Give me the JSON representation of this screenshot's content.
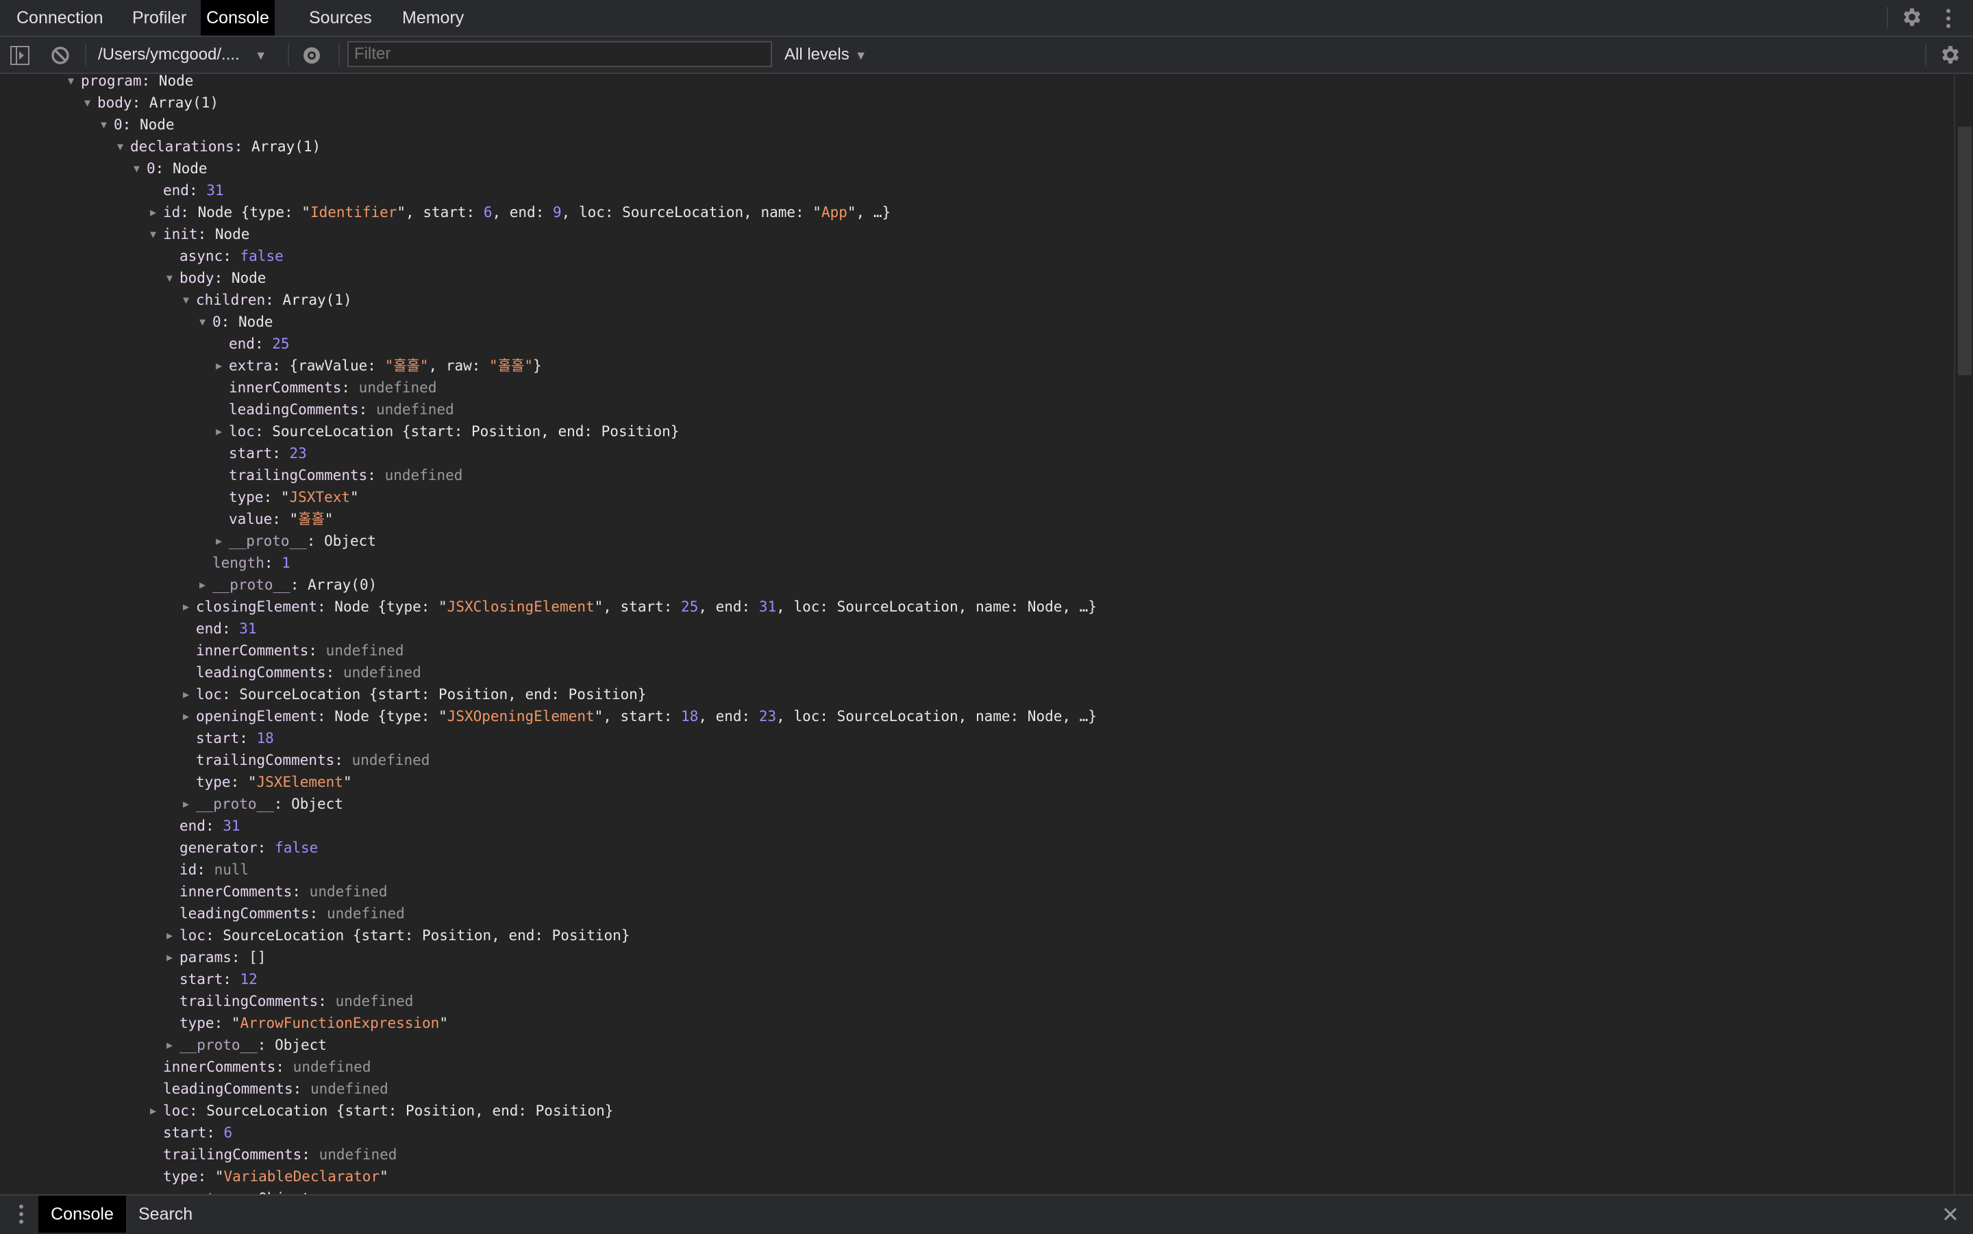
{
  "top_tabs": [
    {
      "label": "Connection",
      "active": false
    },
    {
      "label": "Profiler",
      "active": false
    },
    {
      "label": "Console",
      "active": true
    },
    {
      "label": "Sources",
      "active": false
    },
    {
      "label": "Memory",
      "active": false
    }
  ],
  "toolbar": {
    "context": "/Users/ymcgood/....",
    "filter_placeholder": "Filter",
    "levels": "All levels"
  },
  "icons": {
    "sidebar_toggle": "sidebar-toggle-icon",
    "clear": "block-icon",
    "eye": "eye-icon",
    "settings": "gear-icon",
    "more": "kebab-icon",
    "close": "close-icon"
  },
  "colors": {
    "key": "#e9d5f4",
    "number": "#9d8cff",
    "string": "#f29766",
    "undefined": "#9a9a9a"
  },
  "console_lines": [
    {
      "d": 0,
      "a": "open",
      "s": [
        [
          "k",
          "program"
        ],
        [
          "p",
          ": Node"
        ]
      ]
    },
    {
      "d": 1,
      "a": "open",
      "s": [
        [
          "k",
          "body"
        ],
        [
          "p",
          ": Array(1)"
        ]
      ]
    },
    {
      "d": 2,
      "a": "open",
      "s": [
        [
          "k",
          "0"
        ],
        [
          "p",
          ": Node"
        ]
      ]
    },
    {
      "d": 3,
      "a": "open",
      "s": [
        [
          "k",
          "declarations"
        ],
        [
          "p",
          ": Array(1)"
        ]
      ]
    },
    {
      "d": 4,
      "a": "open",
      "s": [
        [
          "k",
          "0"
        ],
        [
          "p",
          ": Node"
        ]
      ]
    },
    {
      "d": 5,
      "a": "",
      "s": [
        [
          "k",
          "end"
        ],
        [
          "p",
          ": "
        ],
        [
          "num",
          "31"
        ]
      ]
    },
    {
      "d": 5,
      "a": "closed",
      "s": [
        [
          "k",
          "id"
        ],
        [
          "p",
          ": Node {type: \""
        ],
        [
          "str",
          "Identifier"
        ],
        [
          "p",
          "\", start: "
        ],
        [
          "num",
          "6"
        ],
        [
          "p",
          ", end: "
        ],
        [
          "num",
          "9"
        ],
        [
          "p",
          ", loc: SourceLocation, name: \""
        ],
        [
          "str",
          "App"
        ],
        [
          "p",
          "\", …}"
        ]
      ]
    },
    {
      "d": 5,
      "a": "open",
      "s": [
        [
          "k",
          "init"
        ],
        [
          "p",
          ": Node"
        ]
      ]
    },
    {
      "d": 6,
      "a": "",
      "s": [
        [
          "k",
          "async"
        ],
        [
          "p",
          ": "
        ],
        [
          "kw",
          "false"
        ]
      ]
    },
    {
      "d": 6,
      "a": "open",
      "s": [
        [
          "k",
          "body"
        ],
        [
          "p",
          ": Node"
        ]
      ]
    },
    {
      "d": 7,
      "a": "open",
      "s": [
        [
          "k",
          "children"
        ],
        [
          "p",
          ": Array(1)"
        ]
      ]
    },
    {
      "d": 8,
      "a": "open",
      "s": [
        [
          "k",
          "0"
        ],
        [
          "p",
          ": Node"
        ]
      ]
    },
    {
      "d": 9,
      "a": "",
      "s": [
        [
          "k",
          "end"
        ],
        [
          "p",
          ": "
        ],
        [
          "num",
          "25"
        ]
      ]
    },
    {
      "d": 9,
      "a": "closed",
      "s": [
        [
          "k",
          "extra"
        ],
        [
          "p",
          ": {rawValue: "
        ],
        [
          "str",
          "\"홀홀\""
        ],
        [
          "p",
          ", raw: "
        ],
        [
          "str",
          "\"홀홀\""
        ],
        [
          "p",
          "}"
        ]
      ]
    },
    {
      "d": 9,
      "a": "",
      "s": [
        [
          "k",
          "innerComments"
        ],
        [
          "p",
          ": "
        ],
        [
          "und",
          "undefined"
        ]
      ]
    },
    {
      "d": 9,
      "a": "",
      "s": [
        [
          "k",
          "leadingComments"
        ],
        [
          "p",
          ": "
        ],
        [
          "und",
          "undefined"
        ]
      ]
    },
    {
      "d": 9,
      "a": "closed",
      "s": [
        [
          "k",
          "loc"
        ],
        [
          "p",
          ": SourceLocation {start: Position, end: Position}"
        ]
      ]
    },
    {
      "d": 9,
      "a": "",
      "s": [
        [
          "k",
          "start"
        ],
        [
          "p",
          ": "
        ],
        [
          "num",
          "23"
        ]
      ]
    },
    {
      "d": 9,
      "a": "",
      "s": [
        [
          "k",
          "trailingComments"
        ],
        [
          "p",
          ": "
        ],
        [
          "und",
          "undefined"
        ]
      ]
    },
    {
      "d": 9,
      "a": "",
      "s": [
        [
          "k",
          "type"
        ],
        [
          "p",
          ": \""
        ],
        [
          "str",
          "JSXText"
        ],
        [
          "p",
          "\""
        ]
      ]
    },
    {
      "d": 9,
      "a": "",
      "s": [
        [
          "k",
          "value"
        ],
        [
          "p",
          ": \""
        ],
        [
          "str",
          "홀홀"
        ],
        [
          "p",
          "\""
        ]
      ]
    },
    {
      "d": 9,
      "a": "closed",
      "s": [
        [
          "proto",
          "__proto__"
        ],
        [
          "p",
          ": Object"
        ]
      ]
    },
    {
      "d": 8,
      "a": "",
      "s": [
        [
          "proto",
          "length"
        ],
        [
          "p",
          ": "
        ],
        [
          "num",
          "1"
        ]
      ]
    },
    {
      "d": 8,
      "a": "closed",
      "s": [
        [
          "proto",
          "__proto__"
        ],
        [
          "p",
          ": Array(0)"
        ]
      ]
    },
    {
      "d": 7,
      "a": "closed",
      "s": [
        [
          "k",
          "closingElement"
        ],
        [
          "p",
          ": Node {type: \""
        ],
        [
          "str",
          "JSXClosingElement"
        ],
        [
          "p",
          "\", start: "
        ],
        [
          "num",
          "25"
        ],
        [
          "p",
          ", end: "
        ],
        [
          "num",
          "31"
        ],
        [
          "p",
          ", loc: SourceLocation, name: Node, …}"
        ]
      ]
    },
    {
      "d": 7,
      "a": "",
      "s": [
        [
          "k",
          "end"
        ],
        [
          "p",
          ": "
        ],
        [
          "num",
          "31"
        ]
      ]
    },
    {
      "d": 7,
      "a": "",
      "s": [
        [
          "k",
          "innerComments"
        ],
        [
          "p",
          ": "
        ],
        [
          "und",
          "undefined"
        ]
      ]
    },
    {
      "d": 7,
      "a": "",
      "s": [
        [
          "k",
          "leadingComments"
        ],
        [
          "p",
          ": "
        ],
        [
          "und",
          "undefined"
        ]
      ]
    },
    {
      "d": 7,
      "a": "closed",
      "s": [
        [
          "k",
          "loc"
        ],
        [
          "p",
          ": SourceLocation {start: Position, end: Position}"
        ]
      ]
    },
    {
      "d": 7,
      "a": "closed",
      "s": [
        [
          "k",
          "openingElement"
        ],
        [
          "p",
          ": Node {type: \""
        ],
        [
          "str",
          "JSXOpeningElement"
        ],
        [
          "p",
          "\", start: "
        ],
        [
          "num",
          "18"
        ],
        [
          "p",
          ", end: "
        ],
        [
          "num",
          "23"
        ],
        [
          "p",
          ", loc: SourceLocation, name: Node, …}"
        ]
      ]
    },
    {
      "d": 7,
      "a": "",
      "s": [
        [
          "k",
          "start"
        ],
        [
          "p",
          ": "
        ],
        [
          "num",
          "18"
        ]
      ]
    },
    {
      "d": 7,
      "a": "",
      "s": [
        [
          "k",
          "trailingComments"
        ],
        [
          "p",
          ": "
        ],
        [
          "und",
          "undefined"
        ]
      ]
    },
    {
      "d": 7,
      "a": "",
      "s": [
        [
          "k",
          "type"
        ],
        [
          "p",
          ": \""
        ],
        [
          "str",
          "JSXElement"
        ],
        [
          "p",
          "\""
        ]
      ]
    },
    {
      "d": 7,
      "a": "closed",
      "s": [
        [
          "proto",
          "__proto__"
        ],
        [
          "p",
          ": Object"
        ]
      ]
    },
    {
      "d": 6,
      "a": "",
      "s": [
        [
          "k",
          "end"
        ],
        [
          "p",
          ": "
        ],
        [
          "num",
          "31"
        ]
      ]
    },
    {
      "d": 6,
      "a": "",
      "s": [
        [
          "k",
          "generator"
        ],
        [
          "p",
          ": "
        ],
        [
          "kw",
          "false"
        ]
      ]
    },
    {
      "d": 6,
      "a": "",
      "s": [
        [
          "k",
          "id"
        ],
        [
          "p",
          ": "
        ],
        [
          "und",
          "null"
        ]
      ]
    },
    {
      "d": 6,
      "a": "",
      "s": [
        [
          "k",
          "innerComments"
        ],
        [
          "p",
          ": "
        ],
        [
          "und",
          "undefined"
        ]
      ]
    },
    {
      "d": 6,
      "a": "",
      "s": [
        [
          "k",
          "leadingComments"
        ],
        [
          "p",
          ": "
        ],
        [
          "und",
          "undefined"
        ]
      ]
    },
    {
      "d": 6,
      "a": "closed",
      "s": [
        [
          "k",
          "loc"
        ],
        [
          "p",
          ": SourceLocation {start: Position, end: Position}"
        ]
      ]
    },
    {
      "d": 6,
      "a": "closed",
      "s": [
        [
          "k",
          "params"
        ],
        [
          "p",
          ": []"
        ]
      ]
    },
    {
      "d": 6,
      "a": "",
      "s": [
        [
          "k",
          "start"
        ],
        [
          "p",
          ": "
        ],
        [
          "num",
          "12"
        ]
      ]
    },
    {
      "d": 6,
      "a": "",
      "s": [
        [
          "k",
          "trailingComments"
        ],
        [
          "p",
          ": "
        ],
        [
          "und",
          "undefined"
        ]
      ]
    },
    {
      "d": 6,
      "a": "",
      "s": [
        [
          "k",
          "type"
        ],
        [
          "p",
          ": \""
        ],
        [
          "str",
          "ArrowFunctionExpression"
        ],
        [
          "p",
          "\""
        ]
      ]
    },
    {
      "d": 6,
      "a": "closed",
      "s": [
        [
          "proto",
          "__proto__"
        ],
        [
          "p",
          ": Object"
        ]
      ]
    },
    {
      "d": 5,
      "a": "",
      "s": [
        [
          "k",
          "innerComments"
        ],
        [
          "p",
          ": "
        ],
        [
          "und",
          "undefined"
        ]
      ]
    },
    {
      "d": 5,
      "a": "",
      "s": [
        [
          "k",
          "leadingComments"
        ],
        [
          "p",
          ": "
        ],
        [
          "und",
          "undefined"
        ]
      ]
    },
    {
      "d": 5,
      "a": "closed",
      "s": [
        [
          "k",
          "loc"
        ],
        [
          "p",
          ": SourceLocation {start: Position, end: Position}"
        ]
      ]
    },
    {
      "d": 5,
      "a": "",
      "s": [
        [
          "k",
          "start"
        ],
        [
          "p",
          ": "
        ],
        [
          "num",
          "6"
        ]
      ]
    },
    {
      "d": 5,
      "a": "",
      "s": [
        [
          "k",
          "trailingComments"
        ],
        [
          "p",
          ": "
        ],
        [
          "und",
          "undefined"
        ]
      ]
    },
    {
      "d": 5,
      "a": "",
      "s": [
        [
          "k",
          "type"
        ],
        [
          "p",
          ": \""
        ],
        [
          "str",
          "VariableDeclarator"
        ],
        [
          "p",
          "\""
        ]
      ]
    },
    {
      "d": 5,
      "a": "closed",
      "s": [
        [
          "proto",
          "__proto__"
        ],
        [
          "p",
          ": Object"
        ]
      ]
    }
  ],
  "bottom_tabs": [
    {
      "label": "Console",
      "active": true
    },
    {
      "label": "Search",
      "active": false
    }
  ]
}
